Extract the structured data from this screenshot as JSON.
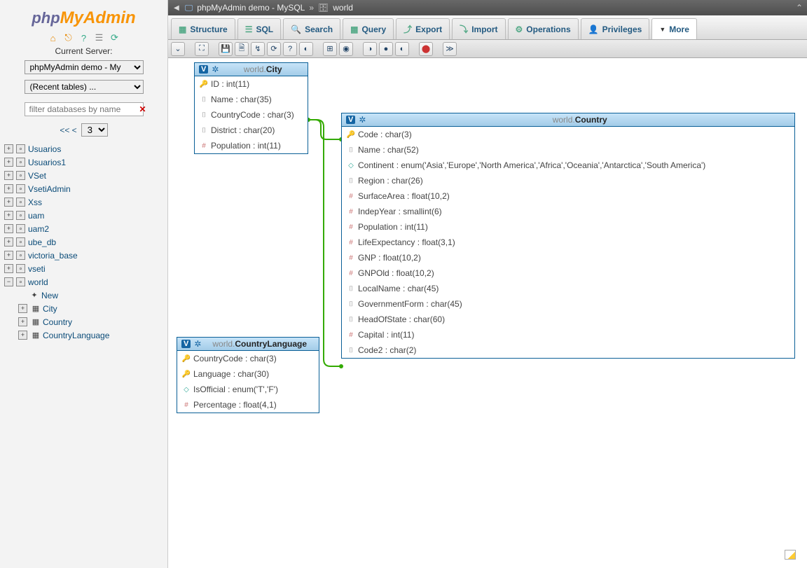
{
  "logo": {
    "php": "php",
    "my": "My",
    "admin": "Admin"
  },
  "sidebar": {
    "server_label": "Current Server:",
    "server_select": "phpMyAdmin demo - My",
    "recent_select": "(Recent tables) ...",
    "filter_placeholder": "filter databases by name",
    "pager_prev": "<< <",
    "pager_page": "3",
    "dbs": [
      {
        "name": "Usuarios"
      },
      {
        "name": "Usuarios1"
      },
      {
        "name": "VSet"
      },
      {
        "name": "VsetiAdmin"
      },
      {
        "name": "Xss"
      },
      {
        "name": "uam"
      },
      {
        "name": "uam2"
      },
      {
        "name": "ube_db"
      },
      {
        "name": "victoria_base"
      },
      {
        "name": "vseti"
      }
    ],
    "expanded_db": "world",
    "expanded_children": [
      {
        "icon": "new",
        "label": "New"
      },
      {
        "icon": "table",
        "label": "City",
        "expandable": true
      },
      {
        "icon": "table",
        "label": "Country",
        "expandable": true
      },
      {
        "icon": "table",
        "label": "CountryLanguage",
        "expandable": true
      }
    ]
  },
  "breadcrumb": {
    "server": "phpMyAdmin demo - MySQL",
    "db": "world"
  },
  "tabs": [
    {
      "label": "Structure"
    },
    {
      "label": "SQL"
    },
    {
      "label": "Search"
    },
    {
      "label": "Query"
    },
    {
      "label": "Export"
    },
    {
      "label": "Import"
    },
    {
      "label": "Operations"
    },
    {
      "label": "Privileges"
    },
    {
      "label": "More",
      "active": true
    }
  ],
  "entities": {
    "city": {
      "schema": "world",
      "table": "City",
      "cols": [
        {
          "icon": "key",
          "text": "ID : int(11)"
        },
        {
          "icon": "txt",
          "text": "Name : char(35)"
        },
        {
          "icon": "txt",
          "text": "CountryCode : char(3)"
        },
        {
          "icon": "txt",
          "text": "District : char(20)"
        },
        {
          "icon": "num",
          "text": "Population : int(11)"
        }
      ]
    },
    "country": {
      "schema": "world",
      "table": "Country",
      "cols": [
        {
          "icon": "key",
          "text": "Code : char(3)"
        },
        {
          "icon": "txt",
          "text": "Name : char(52)"
        },
        {
          "icon": "enum",
          "text": "Continent : enum('Asia','Europe','North America','Africa','Oceania','Antarctica','South America')"
        },
        {
          "icon": "txt",
          "text": "Region : char(26)"
        },
        {
          "icon": "num",
          "text": "SurfaceArea : float(10,2)"
        },
        {
          "icon": "num",
          "text": "IndepYear : smallint(6)"
        },
        {
          "icon": "num",
          "text": "Population : int(11)"
        },
        {
          "icon": "num",
          "text": "LifeExpectancy : float(3,1)"
        },
        {
          "icon": "num",
          "text": "GNP : float(10,2)"
        },
        {
          "icon": "num",
          "text": "GNPOld : float(10,2)"
        },
        {
          "icon": "txt",
          "text": "LocalName : char(45)"
        },
        {
          "icon": "txt",
          "text": "GovernmentForm : char(45)"
        },
        {
          "icon": "txt",
          "text": "HeadOfState : char(60)"
        },
        {
          "icon": "num",
          "text": "Capital : int(11)"
        },
        {
          "icon": "txt",
          "text": "Code2 : char(2)"
        }
      ]
    },
    "countrylang": {
      "schema": "world",
      "table": "CountryLanguage",
      "cols": [
        {
          "icon": "key",
          "text": "CountryCode : char(3)"
        },
        {
          "icon": "key",
          "text": "Language : char(30)"
        },
        {
          "icon": "enum",
          "text": "IsOfficial : enum('T','F')"
        },
        {
          "icon": "num",
          "text": "Percentage : float(4,1)"
        }
      ]
    }
  }
}
